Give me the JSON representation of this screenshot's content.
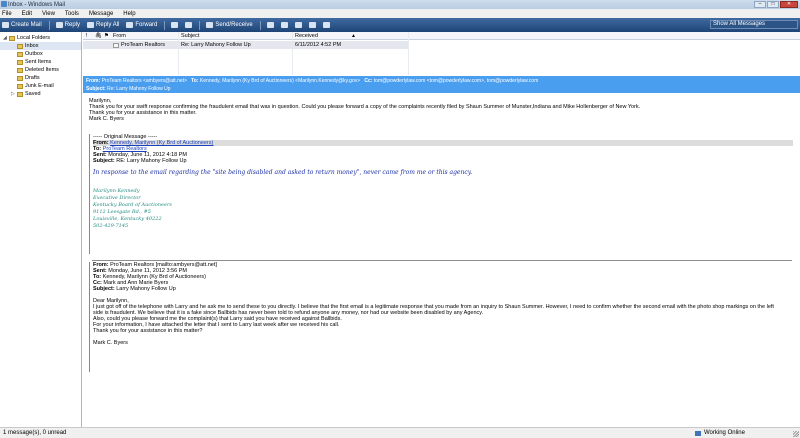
{
  "window": {
    "title": "Inbox - Windows Mail"
  },
  "menu": [
    "File",
    "Edit",
    "View",
    "Tools",
    "Message",
    "Help"
  ],
  "toolbar": {
    "create": "Create Mail",
    "reply": "Reply",
    "reply_all": "Reply All",
    "forward": "Forward",
    "send_receive": "Send/Receive",
    "view_selector": "Show All Messages"
  },
  "folders": {
    "root": "Local Folders",
    "items": [
      "Inbox",
      "Outbox",
      "Sent Items",
      "Deleted Items",
      "Drafts",
      "Junk E-mail",
      "Saved"
    ]
  },
  "list": {
    "columns": {
      "flag": "!",
      "attach": "🖇",
      "star": "⚑",
      "from": "From",
      "subject": "Subject",
      "received": "Received"
    },
    "row": {
      "from": "ProTeam Realtors",
      "subject": "Re: Larry Mahony Follow Up",
      "received": "6/11/2012 4:52 PM"
    }
  },
  "preview": {
    "from_label": "From:",
    "from": "ProTeam Realtors <ambyers@att.net>",
    "to_label": "To:",
    "to": "Kennedy, Marilynn (Ky Brd of Auctioneers) <Marilynn.Kennedy@ky.gov>",
    "cc_label": "Cc:",
    "cc": "tom@powderlylaw.com <tom@powderlylaw.com>, tom@powderlylaw.com",
    "subject_label": "Subject:",
    "subject": "Re: Larry Mahony Follow Up"
  },
  "body": {
    "intro": [
      "Marilynn,",
      "Thank you for your swift response confirming the fraudulent email that was in question. Could you please forward a copy of the complaints recently filed by Shaun Summer of Munster,Indiana and Mike Hollenberger of New York.",
      "Thank you for your assistance in this matter.",
      "Mark C. Byers"
    ],
    "q1": {
      "divider": "----- Original Message -----",
      "from_label": "From:",
      "from": "Kennedy, Marilynn (Ky Brd of Auctioneers)",
      "to_label": "To:",
      "to": "ProTeam Realtors",
      "sent_label": "Sent:",
      "sent": "Monday, June 11, 2012 4:18 PM",
      "subject_label": "Subject:",
      "subject": "RE: Larry Mahony Follow Up",
      "message": "In response to the email regarding the \"site being disabled and asked to return money\", never came from me or this agency.",
      "signature": [
        "Marilynn Kennedy",
        "Executive Director",
        "Kentucky Board of Auctioneers",
        "9112 Leesgate Rd., #5",
        "Louisville, Kentucky 40222",
        "502-429-7145"
      ]
    },
    "q2": {
      "from_label": "From:",
      "from": "ProTeam Realtors [mailto:ambyers@att.net]",
      "sent_label": "Sent:",
      "sent": "Monday, June 11, 2012 3:56 PM",
      "to_label": "To:",
      "to": "Kennedy, Marilynn (Ky Brd of Auctioneers)",
      "cc_label": "Cc:",
      "cc": "Mark and Ann Marie Byers",
      "subject_label": "Subject:",
      "subject": "Larry Mahony Follow Up",
      "lines": [
        "Dear Marilynn,",
        "I just got off of the telephone with Larry and he ask me to send these to you directly. I believe that the first email is a legitimate response that you made from an inquiry to Shaun Summer. However, I need to confirm whether the second email with the photo shop markings on the left",
        "side is fraudulent. We believe that it is a fake since Ballbids has never been told to refund anyone any money, nor had our website been disabled by any Agency.",
        "Also, could you please forward me the complaint(s) that Larry said you have received against Ballbids.",
        "For your information, I have attached the letter that I sent to Larry last week after we received his call.",
        "Thank you for your assistance in this matter?",
        "Mark C. Byers"
      ]
    }
  },
  "status": {
    "count": "1 message(s), 0 unread",
    "online": "Working Online"
  }
}
